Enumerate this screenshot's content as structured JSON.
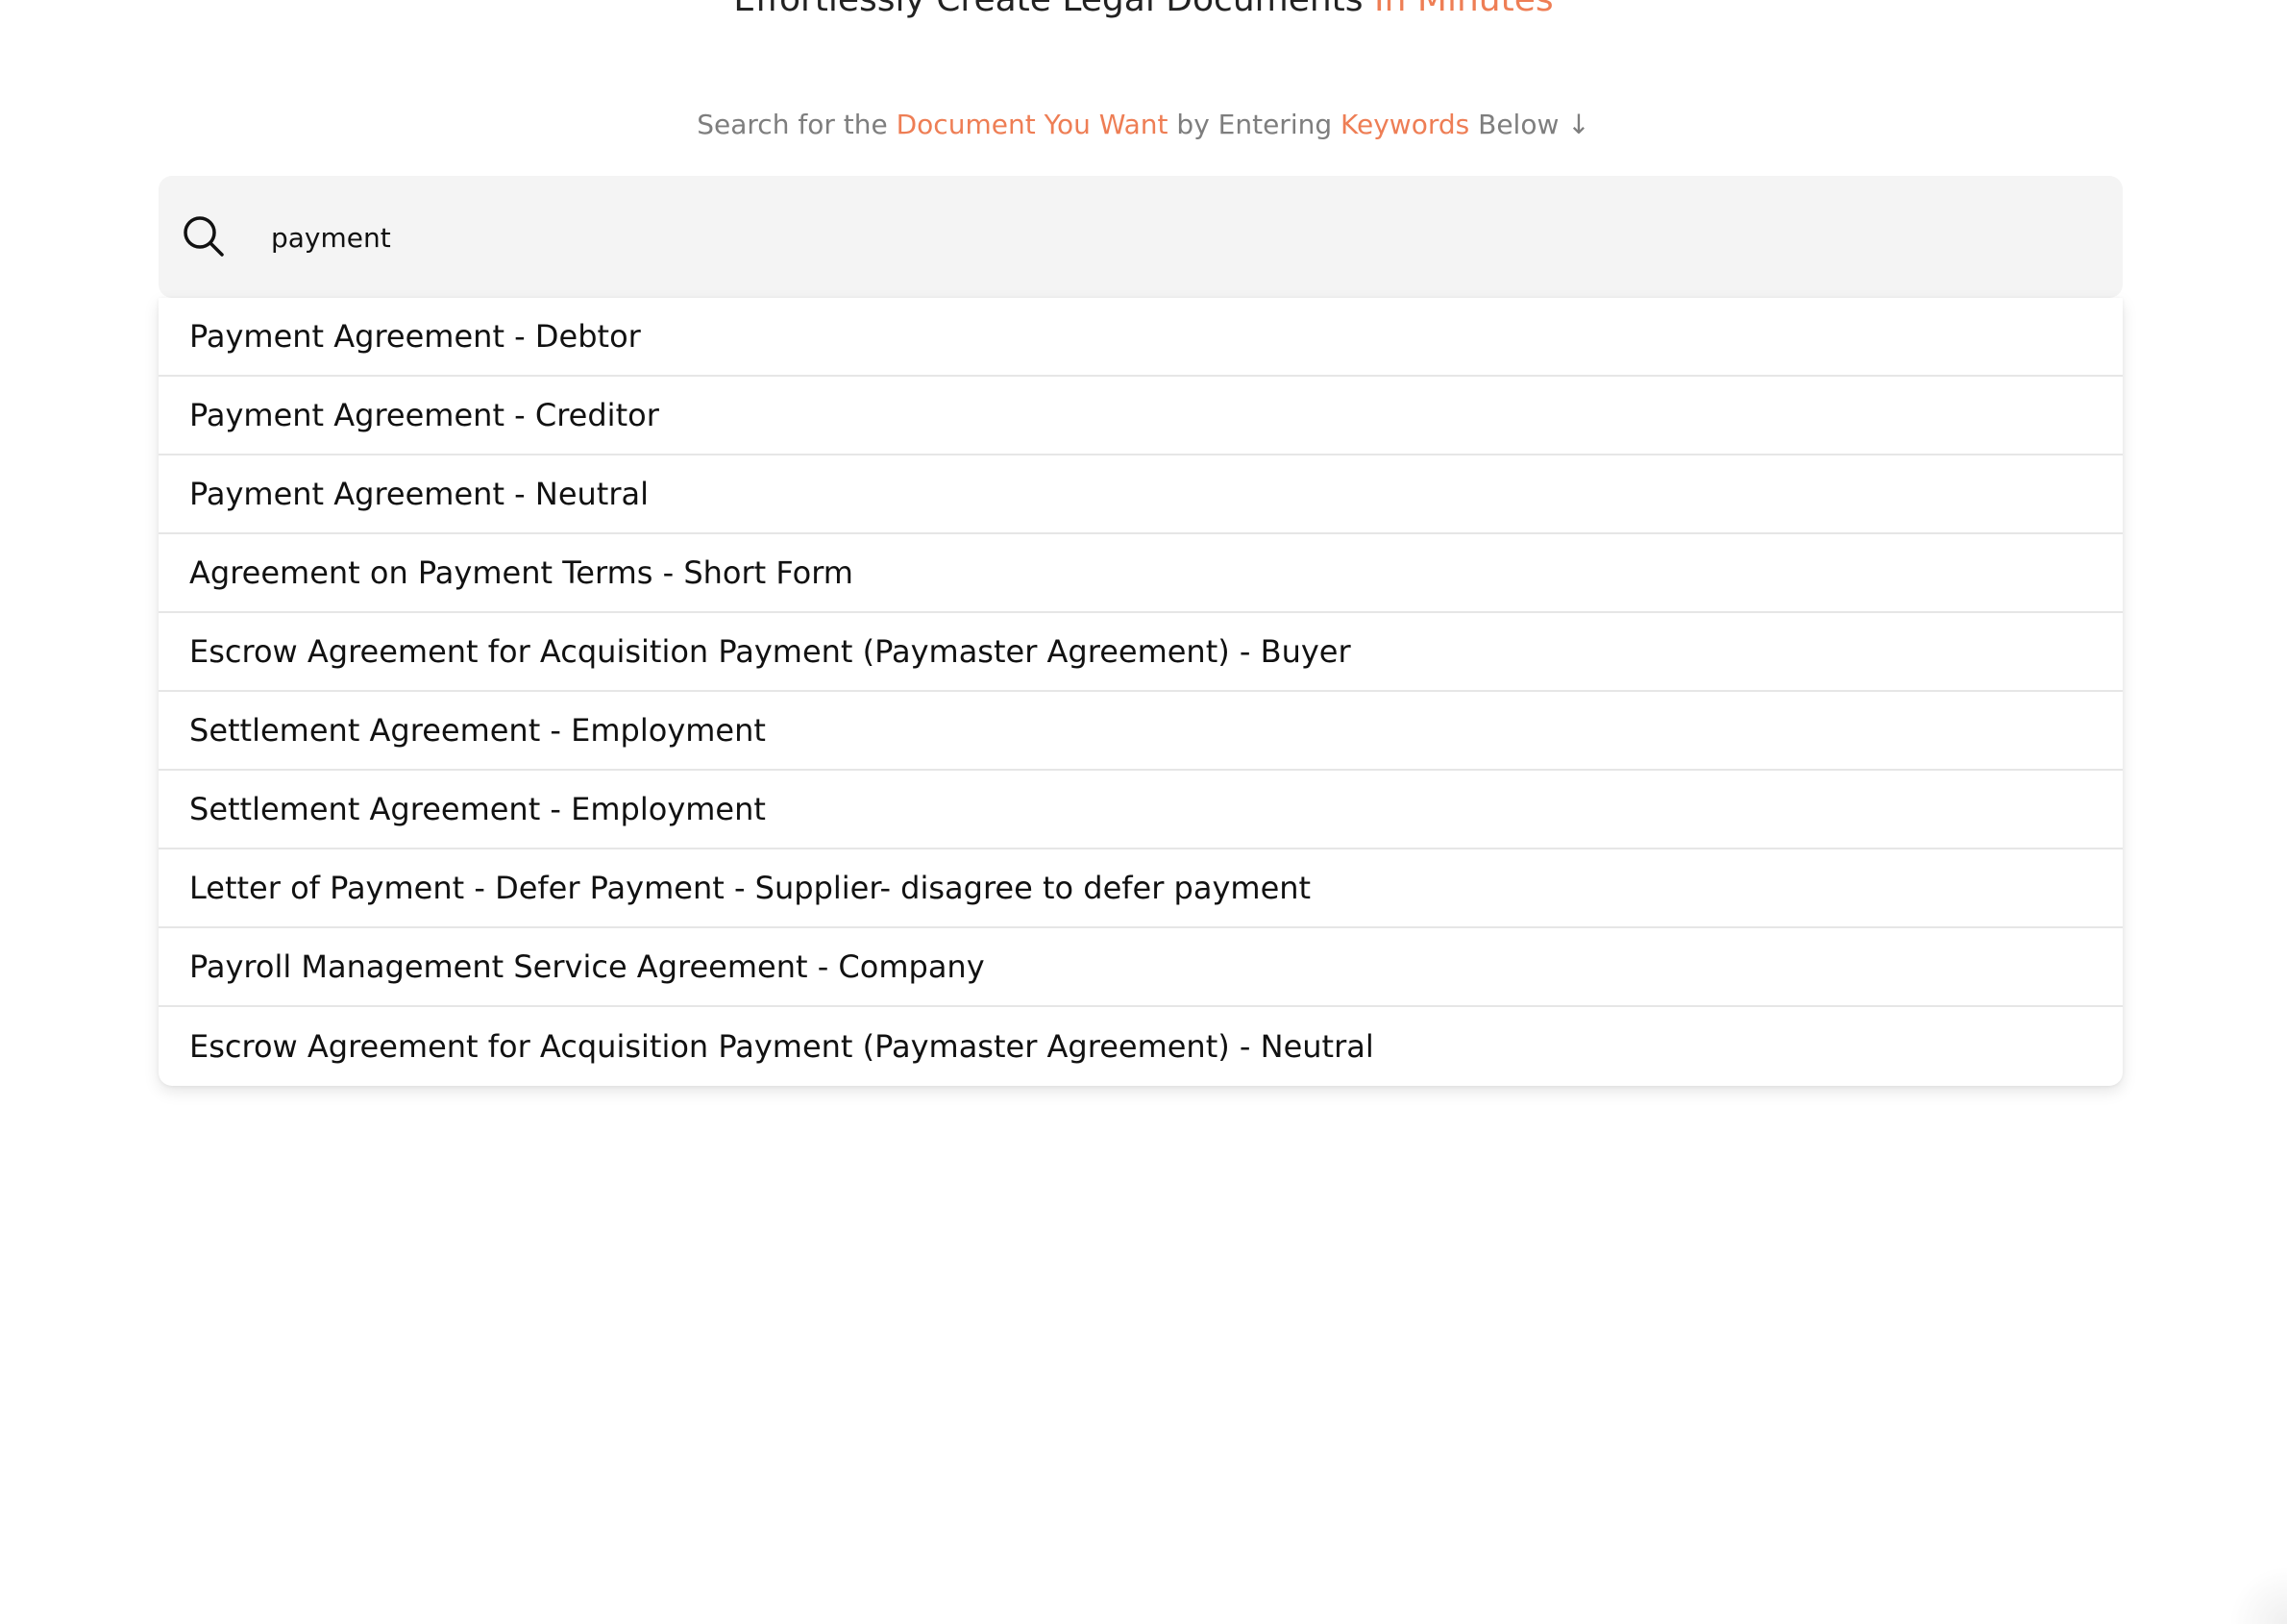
{
  "header": {
    "title_main": "Effortlessly Create Legal Documents",
    "title_accent": "In Minutes"
  },
  "subheader": {
    "part1": "Search for the",
    "accent1": "Document You Want",
    "part2": "by Entering",
    "accent2": "Keywords",
    "part3": "Below ↓"
  },
  "search": {
    "value": "payment",
    "icon": "search-icon"
  },
  "results": [
    "Payment Agreement - Debtor",
    "Payment Agreement - Creditor",
    "Payment Agreement - Neutral",
    "Agreement on Payment Terms - Short Form",
    "Escrow Agreement for Acquisition Payment (Paymaster Agreement) - Buyer",
    "Settlement Agreement - Employment",
    "Settlement Agreement - Employment",
    "Letter of Payment - Defer Payment - Supplier- disagree to defer payment",
    "Payroll Management Service Agreement - Company",
    "Escrow Agreement for Acquisition Payment (Paymaster Agreement) - Neutral"
  ],
  "colors": {
    "accent": "#ee7e55",
    "search_bg": "#f4f4f4",
    "muted_text": "#7e7e7e"
  }
}
